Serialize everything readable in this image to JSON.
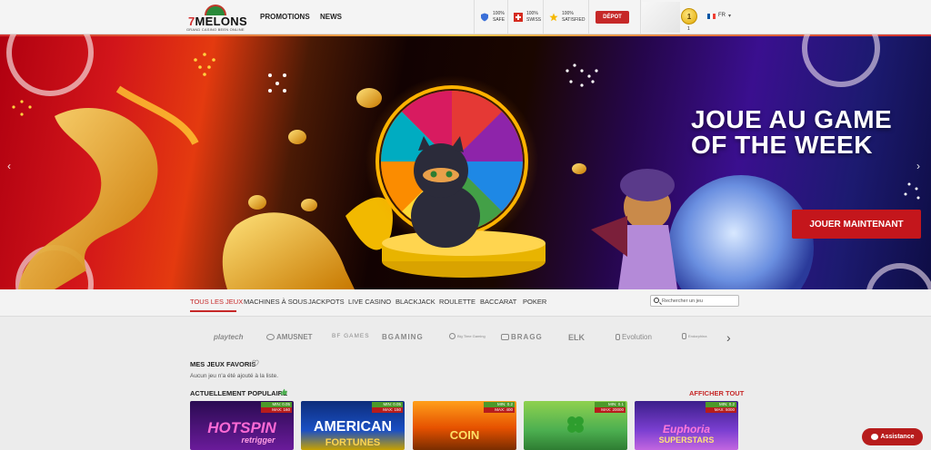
{
  "header": {
    "logo_text": "MELONS",
    "logo_seven": "7",
    "logo_tagline": "GRAND CASINO BEEN ONLINE",
    "nav": [
      "PROMOTIONS",
      "NEWS"
    ],
    "trust": [
      {
        "line1": "100%",
        "line2": "SAFE",
        "icon": "shield-icon"
      },
      {
        "line1": "100%",
        "line2": "SWISS",
        "icon": "swiss-flag-icon"
      },
      {
        "line1": "100%",
        "line2": "SATISFIED",
        "icon": "star-icon"
      }
    ],
    "deposit_label": "DÉPOT",
    "coin_value": "1",
    "coin_count": "1",
    "language": "FR"
  },
  "hero": {
    "title_line1": "JOUE AU GAME",
    "title_line2": "OF THE WEEK",
    "cta": "JOUER MAINTENANT"
  },
  "categories": {
    "tabs": [
      "TOUS LES JEUX",
      "MACHINES À SOUS",
      "JACKPOTS",
      "LIVE CASINO",
      "BLACKJACK",
      "ROULETTE",
      "BACCARAT",
      "POKER"
    ],
    "active": "TOUS LES JEUX",
    "search_placeholder": "Rechercher un jeu"
  },
  "providers": [
    "playtech",
    "AMUSNET",
    "BF GAMES",
    "BGAMING",
    "Big Time Gaming",
    "BRAGG",
    "ELK",
    "Evolution",
    "Endorphina"
  ],
  "favorites": {
    "title": "MES JEUX FAVORIS",
    "empty_text": "Aucun jeu n'a été ajouté à la liste."
  },
  "popular": {
    "title": "ACTUELLEMENT POPULAIRE",
    "show_all": "AFFICHER TOUT",
    "games": [
      {
        "title": "HOTSPIN",
        "subtitle": "retrigger",
        "min": "MIN: 0.05",
        "max": "MAX: 160"
      },
      {
        "title": "AMERICAN",
        "subtitle": "FORTUNES",
        "min": "MIN: 0.05",
        "max": "MAX: 150"
      },
      {
        "title": "COIN",
        "subtitle": "",
        "min": "MIN: 0.2",
        "max": "MAX: 400"
      },
      {
        "title": "",
        "subtitle": "",
        "min": "MIN: 0.1",
        "max": "MAX: 20000"
      },
      {
        "title": "Euphoria",
        "subtitle": "SUPERSTARS",
        "min": "MIN: 0.2",
        "max": "MAX: 5000"
      }
    ]
  },
  "assist_label": "Assistance"
}
